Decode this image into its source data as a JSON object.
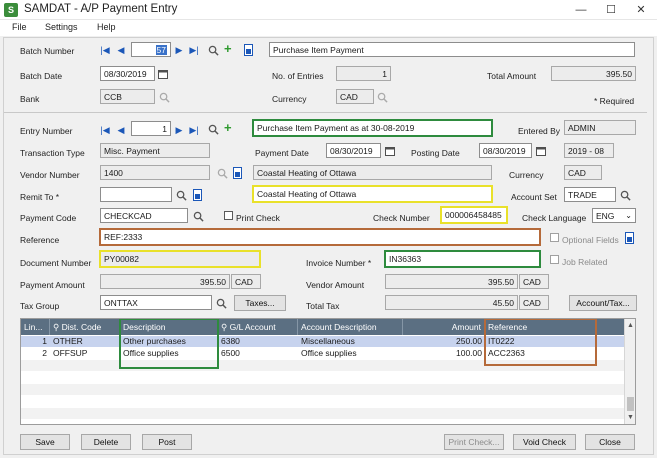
{
  "window": {
    "title": "SAMDAT - A/P Payment Entry",
    "minimize": "—",
    "maximize": "☐",
    "close": "✕"
  },
  "menu": [
    "File",
    "Settings",
    "Help"
  ],
  "batch": {
    "number_label": "Batch Number",
    "number": "57",
    "description": "Purchase Item Payment",
    "date_label": "Batch Date",
    "date": "08/30/2019",
    "entries_label": "No. of Entries",
    "entries": "1",
    "total_label": "Total Amount",
    "total": "395.50",
    "bank_label": "Bank",
    "bank": "CCB",
    "currency_label": "Currency",
    "currency": "CAD",
    "required_note": "*  Required"
  },
  "entry": {
    "number_label": "Entry Number",
    "number": "1",
    "description": "Purchase Item Payment as at 30-08-2019",
    "entered_by_label": "Entered By",
    "entered_by": "ADMIN",
    "type_label": "Transaction Type",
    "type": "Misc. Payment",
    "payment_date_label": "Payment Date",
    "payment_date": "08/30/2019",
    "posting_date_label": "Posting Date",
    "posting_date": "08/30/2019",
    "period": "2019 - 08",
    "vendor_label": "Vendor Number",
    "vendor": "1400",
    "vendor_name": "Coastal Heating of Ottawa",
    "currency_label": "Currency",
    "currency": "CAD",
    "remit_label": "Remit To *",
    "remit": "",
    "remit_name": "Coastal Heating of Ottawa",
    "account_set_label": "Account Set",
    "account_set": "TRADE",
    "payment_code_label": "Payment Code",
    "payment_code": "CHECKCAD",
    "print_check_label": "Print Check",
    "check_number_label": "Check Number",
    "check_number": "000006458485",
    "check_language_label": "Check Language",
    "check_language": "ENG",
    "reference_label": "Reference",
    "reference": "REF:2333",
    "optional_fields_label": "Optional Fields",
    "document_label": "Document Number",
    "document": "PY00082",
    "invoice_label": "Invoice Number *",
    "invoice": "IN36363",
    "job_related_label": "Job Related",
    "payment_amount_label": "Payment Amount",
    "payment_amount": "395.50",
    "payment_currency": "CAD",
    "vendor_amount_label": "Vendor Amount",
    "vendor_amount": "395.50",
    "vendor_currency": "CAD",
    "tax_group_label": "Tax Group",
    "tax_group": "ONTTAX",
    "taxes_button": "Taxes...",
    "total_tax_label": "Total Tax",
    "total_tax": "45.50",
    "tax_currency": "CAD",
    "account_tax_button": "Account/Tax..."
  },
  "grid": {
    "headers": [
      "Lin...",
      "Dist. Code",
      "Description",
      "G/L Account",
      "Account Description",
      "Amount",
      "Reference"
    ],
    "rows": [
      [
        "1",
        "OTHER",
        "Other purchases",
        "6380",
        "Miscellaneous",
        "250.00",
        "IT0222"
      ],
      [
        "2",
        "OFFSUP",
        "Office supplies",
        "6500",
        "Office supplies",
        "100.00",
        "ACC2363"
      ]
    ]
  },
  "buttons": {
    "save": "Save",
    "delete": "Delete",
    "post": "Post",
    "print_check": "Print Check...",
    "void_check": "Void Check",
    "close": "Close"
  },
  "colors": {
    "grid_header": "#5b6f82",
    "row_selected": "#c7d3ee",
    "highlight_green": "#2e8b3e",
    "highlight_yellow": "#e9e12a",
    "highlight_brown": "#b56a3a"
  }
}
